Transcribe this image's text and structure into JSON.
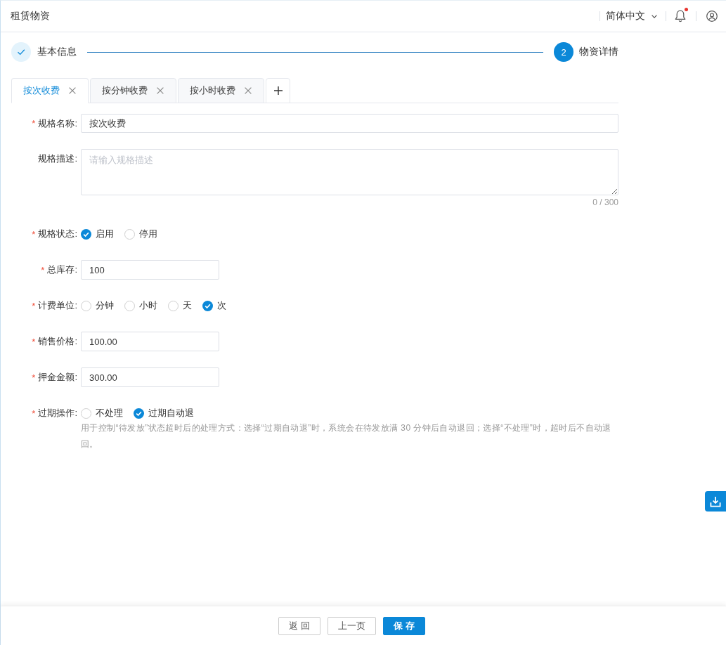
{
  "header": {
    "title": "租赁物资",
    "language": "简体中文",
    "unread": true
  },
  "steps": [
    {
      "kind": "done",
      "label": "基本信息"
    },
    {
      "kind": "current",
      "number": "2",
      "label": "物资详情"
    }
  ],
  "tabs": [
    {
      "label": "按次收费",
      "selected": true
    },
    {
      "label": "按分钟收费",
      "selected": false
    },
    {
      "label": "按小时收费",
      "selected": false
    }
  ],
  "form": {
    "fields": [
      {
        "kind": "text",
        "required_mark": "*",
        "label": "规格名称:",
        "value": "按次收费"
      },
      {
        "kind": "textarea",
        "label": "规格描述:",
        "placeholder": "请输入规格描述",
        "counter": "0 / 300"
      },
      {
        "kind": "radio",
        "required_mark": "*",
        "label": "规格状态:",
        "options": [
          {
            "label": "启用",
            "selected": true
          },
          {
            "label": "停用",
            "selected": false
          }
        ]
      },
      {
        "kind": "number",
        "required_mark": "*",
        "label": "总库存:",
        "value": "100"
      },
      {
        "kind": "radio",
        "required_mark": "*",
        "label": "计费单位:",
        "options": [
          {
            "label": "分钟",
            "selected": false
          },
          {
            "label": "小时",
            "selected": false
          },
          {
            "label": "天",
            "selected": false
          },
          {
            "label": "次",
            "selected": true
          }
        ]
      },
      {
        "kind": "number",
        "required_mark": "*",
        "label": "销售价格:",
        "value": "100.00"
      },
      {
        "kind": "number",
        "required_mark": "*",
        "label": "押金金额:",
        "value": "300.00"
      },
      {
        "kind": "radio",
        "required_mark": "*",
        "label": "过期操作:",
        "options": [
          {
            "label": "不处理",
            "selected": false
          },
          {
            "label": "过期自动退",
            "selected": true
          }
        ],
        "hint": "用于控制“待发放”状态超时后的处理方式：选择“过期自动退”时，系统会在待发放满 30 分钟后自动退回；选择“不处理”时，超时后不自动退回。"
      }
    ]
  },
  "footer": {
    "buttons": [
      {
        "kind": "default",
        "label": "返 回"
      },
      {
        "kind": "default",
        "label": "上一页"
      },
      {
        "kind": "primary",
        "label": "保 存"
      }
    ]
  }
}
